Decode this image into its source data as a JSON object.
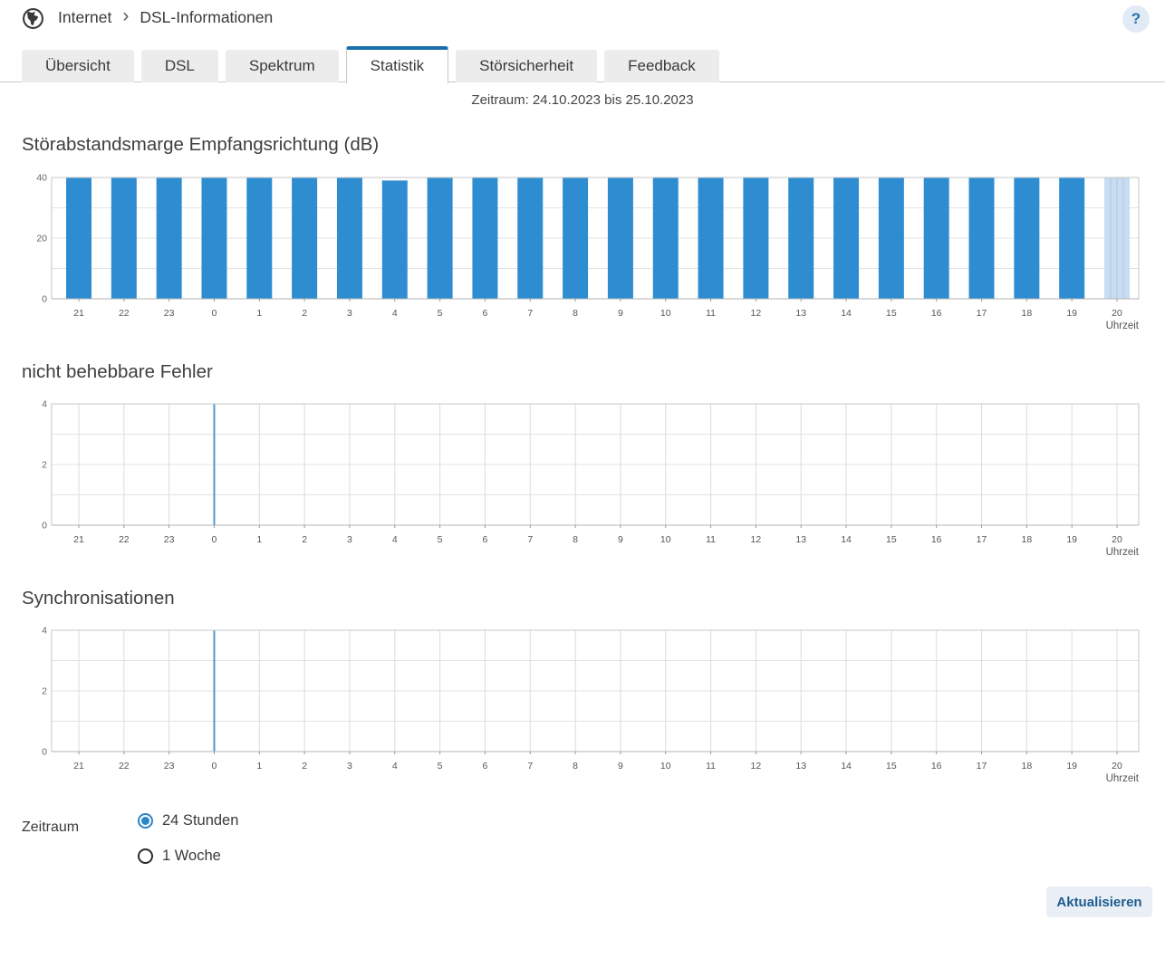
{
  "header": {
    "breadcrumb": {
      "section": "Internet",
      "separator": "›",
      "page": "DSL-Informationen"
    },
    "help_label": "?"
  },
  "tabs": [
    {
      "label": "Übersicht",
      "active": false
    },
    {
      "label": "DSL",
      "active": false
    },
    {
      "label": "Spektrum",
      "active": false
    },
    {
      "label": "Statistik",
      "active": true
    },
    {
      "label": "Störsicherheit",
      "active": false
    },
    {
      "label": "Feedback",
      "active": false
    }
  ],
  "period_line": "Zeitraum: 24.10.2023 bis 25.10.2023",
  "chart_data": [
    {
      "type": "bar",
      "title": "Störabstandsmarge Empfangsrichtung (dB)",
      "x_tick_labels": [
        "21",
        "22",
        "23",
        "0",
        "1",
        "2",
        "3",
        "4",
        "5",
        "6",
        "7",
        "8",
        "9",
        "10",
        "11",
        "12",
        "13",
        "14",
        "15",
        "16",
        "17",
        "18",
        "19",
        "20"
      ],
      "xlabel": "Uhrzeit",
      "ylim": [
        0,
        40
      ],
      "yticks": [
        0,
        20,
        40
      ],
      "grid_y_step": 10,
      "vertical_gridlines": false,
      "values": [
        40,
        40,
        40,
        40,
        40,
        40,
        40,
        39,
        40,
        40,
        40,
        40,
        40,
        40,
        40,
        40,
        40,
        40,
        40,
        40,
        40,
        40,
        40,
        null
      ],
      "pending_slot_index": 23,
      "bar_color": "#2e8dd1",
      "pending_color": "#c9ddf1",
      "pending_stripe_color": "#b4cfea"
    },
    {
      "type": "bar",
      "title": "nicht behebbare Fehler",
      "x_tick_labels": [
        "21",
        "22",
        "23",
        "0",
        "1",
        "2",
        "3",
        "4",
        "5",
        "6",
        "7",
        "8",
        "9",
        "10",
        "11",
        "12",
        "13",
        "14",
        "15",
        "16",
        "17",
        "18",
        "19",
        "20"
      ],
      "xlabel": "Uhrzeit",
      "ylim": [
        0,
        4
      ],
      "yticks": [
        0,
        2,
        4
      ],
      "grid_y_step": 1,
      "vertical_gridlines": true,
      "values": [
        0,
        0,
        0,
        0,
        0,
        0,
        0,
        0,
        0,
        0,
        0,
        0,
        0,
        0,
        0,
        0,
        0,
        0,
        0,
        0,
        0,
        0,
        0,
        0
      ],
      "midnight_line_index": 3,
      "midnight_color": "#4a9bd5",
      "bar_color": "#2e8dd1"
    },
    {
      "type": "bar",
      "title": "Synchronisationen",
      "x_tick_labels": [
        "21",
        "22",
        "23",
        "0",
        "1",
        "2",
        "3",
        "4",
        "5",
        "6",
        "7",
        "8",
        "9",
        "10",
        "11",
        "12",
        "13",
        "14",
        "15",
        "16",
        "17",
        "18",
        "19",
        "20"
      ],
      "xlabel": "Uhrzeit",
      "ylim": [
        0,
        4
      ],
      "yticks": [
        0,
        2,
        4
      ],
      "grid_y_step": 1,
      "vertical_gridlines": true,
      "values": [
        0,
        0,
        0,
        0,
        0,
        0,
        0,
        0,
        0,
        0,
        0,
        0,
        0,
        0,
        0,
        0,
        0,
        0,
        0,
        0,
        0,
        0,
        0,
        0
      ],
      "midnight_line_index": 3,
      "midnight_color": "#4a9bd5",
      "bar_color": "#2e8dd1"
    }
  ],
  "controls": {
    "group_label": "Zeitraum",
    "options": [
      {
        "label": "24 Stunden",
        "selected": true
      },
      {
        "label": "1 Woche",
        "selected": false
      }
    ],
    "update_button": "Aktualisieren"
  },
  "colors": {
    "accent_tab": "#1c6fae",
    "bar_blue": "#2e8dd1",
    "pending_band": "#c9ddf1",
    "midnight_line": "#4a9bd5",
    "help_bg": "#e1ebf5",
    "help_fg": "#2a6ea6",
    "button_bg": "#e9eff5",
    "button_fg": "#1d5c8f"
  }
}
